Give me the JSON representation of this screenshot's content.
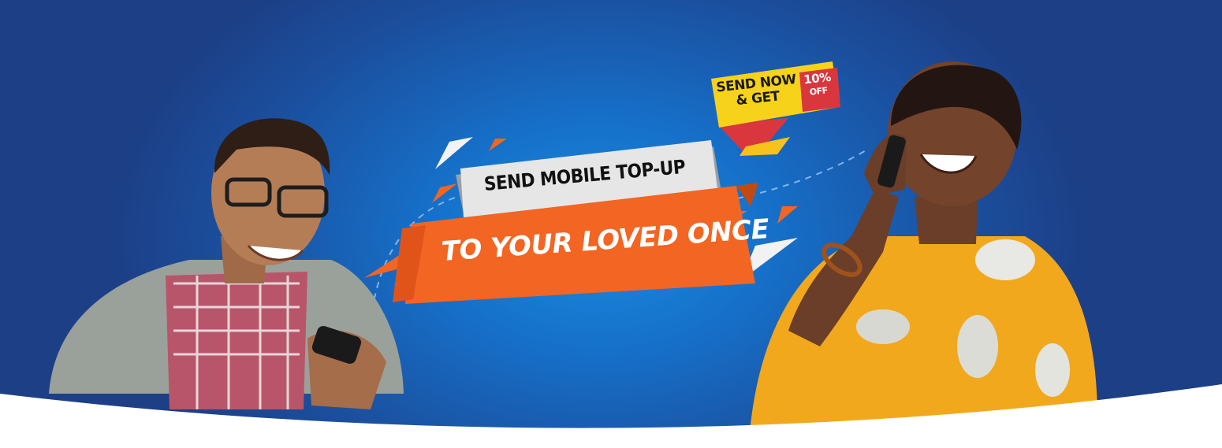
{
  "banner": {
    "headline_top": "SEND MOBILE TOP-UP",
    "headline_bottom": "TO YOUR LOVED ONCE",
    "promo": {
      "line1": "SEND NOW",
      "line2": "& GET",
      "percent": "10%",
      "off": "OFF"
    }
  },
  "colors": {
    "bg_center": "#1a8be0",
    "bg_edge": "#1c3f86",
    "orange": "#f26522",
    "yellow": "#f7d21b",
    "red": "#d9363e",
    "ribbon_light": "#e6e6e6"
  },
  "people": [
    {
      "name": "man-with-phone"
    },
    {
      "name": "woman-on-phone"
    }
  ]
}
